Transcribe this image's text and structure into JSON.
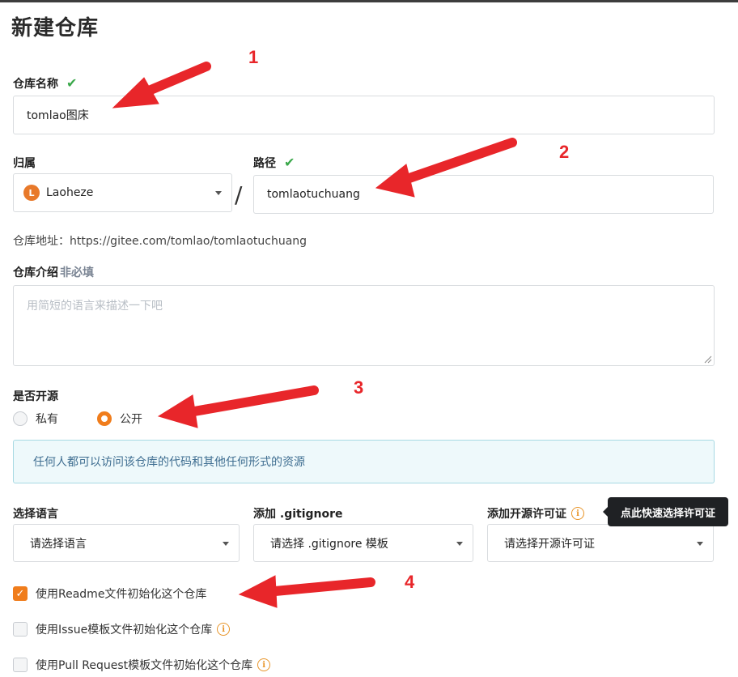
{
  "page": {
    "title": "新建仓库"
  },
  "repo_name": {
    "label": "仓库名称",
    "value": "tomlao图床"
  },
  "owner": {
    "label": "归属",
    "avatar_letter": "L",
    "value": "Laoheze"
  },
  "path": {
    "label": "路径",
    "value": "tomlaotuchuang"
  },
  "separator": "/",
  "repo_url": "仓库地址：https://gitee.com/tomlao/tomlaotuchuang",
  "description": {
    "label": "仓库介绍",
    "optional": "非必填",
    "placeholder": "用简短的语言来描述一下吧"
  },
  "visibility": {
    "label": "是否开源",
    "options": [
      {
        "label": "私有",
        "selected": false
      },
      {
        "label": "公开",
        "selected": true
      }
    ],
    "info": "任何人都可以访问该仓库的代码和其他任何形式的资源"
  },
  "language": {
    "label": "选择语言",
    "value": "请选择语言"
  },
  "gitignore": {
    "label": "添加 .gitignore",
    "value": "请选择 .gitignore 模板"
  },
  "license": {
    "label": "添加开源许可证",
    "value": "请选择开源许可证",
    "tooltip": "点此快速选择许可证"
  },
  "init_options": [
    {
      "label": "使用Readme文件初始化这个仓库",
      "checked": true
    },
    {
      "label": "使用Issue模板文件初始化这个仓库",
      "checked": false
    },
    {
      "label": "使用Pull Request模板文件初始化这个仓库",
      "checked": false
    }
  ],
  "annotations": [
    "1",
    "2",
    "3",
    "4"
  ],
  "colors": {
    "accent": "#f07d1c",
    "check": "#3aa84a",
    "arrow": "#e8262a",
    "info_bg": "#eef9fb"
  }
}
